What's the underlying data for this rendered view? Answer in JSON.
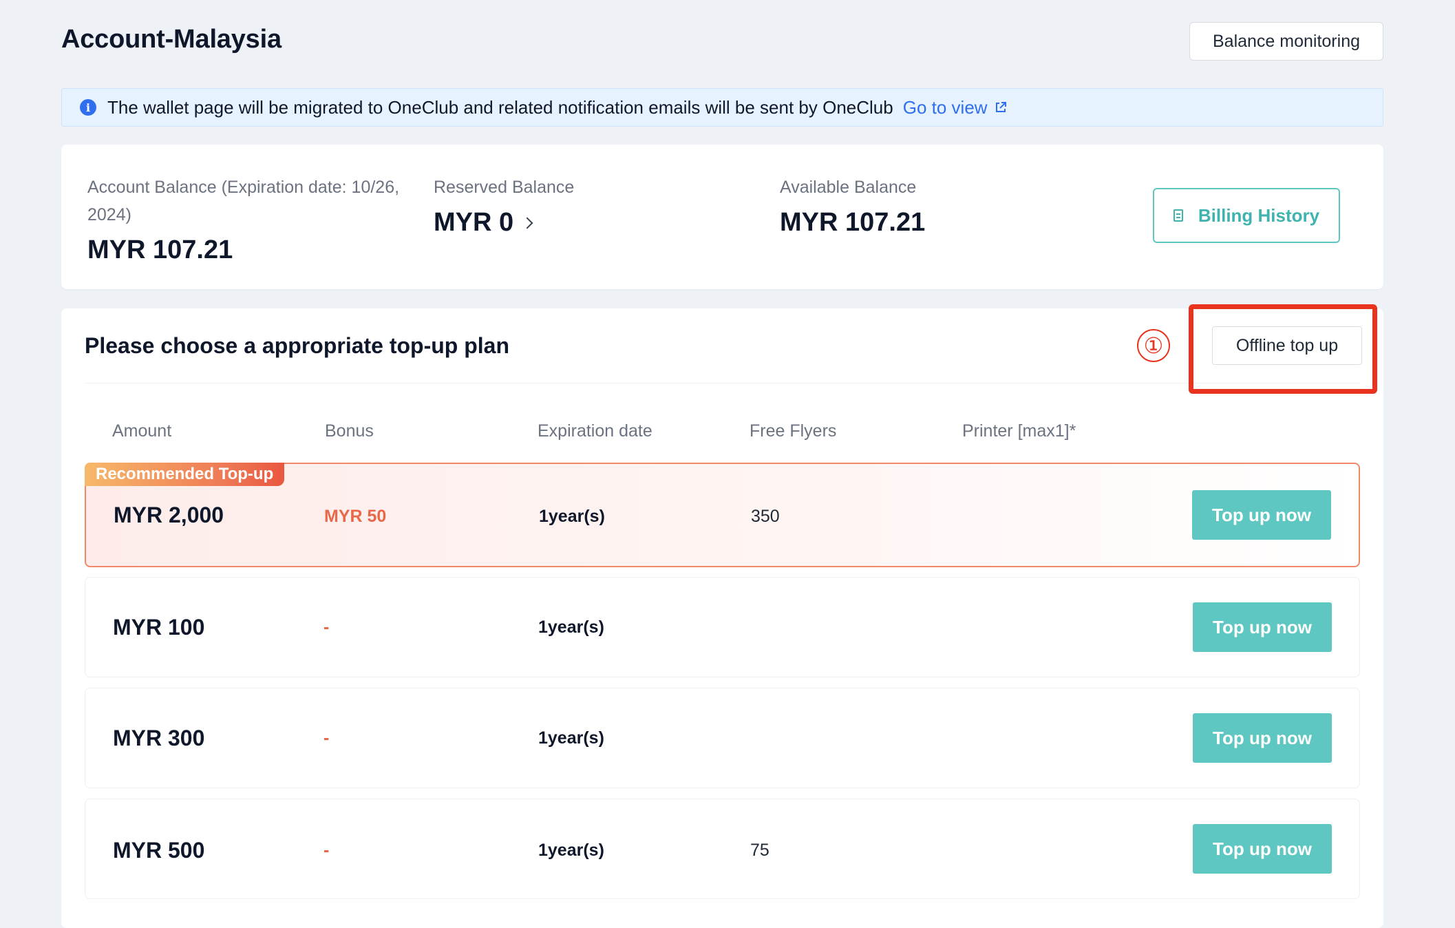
{
  "header": {
    "title": "Account-Malaysia",
    "balance_monitoring_label": "Balance monitoring"
  },
  "notice": {
    "message": "The wallet page will be migrated to OneClub and related notification emails will be sent by OneClub",
    "link_text": "Go to view",
    "icon": "info-icon"
  },
  "balance": {
    "account_label_line1": "Account Balance (Expiration date: 10/26,",
    "account_label_line2": "2024)",
    "account_value": "MYR 107.21",
    "reserved_label": "Reserved Balance",
    "reserved_value": "MYR 0",
    "available_label": "Available Balance",
    "available_value": "MYR 107.21",
    "billing_history_label": "Billing History"
  },
  "plans": {
    "title": "Please choose a appropriate top-up plan",
    "annotation_number": "①",
    "offline_label": "Offline top up",
    "columns": {
      "amount": "Amount",
      "bonus": "Bonus",
      "expiration": "Expiration date",
      "flyers": "Free Flyers",
      "printer": "Printer [max1]*"
    },
    "recommended_badge": "Recommended Top-up",
    "rows": [
      {
        "amount": "MYR 2,000",
        "bonus": "MYR 50",
        "expiration": "1year(s)",
        "flyers": "350",
        "button": "Top up now"
      },
      {
        "amount": "MYR 100",
        "bonus": "-",
        "expiration": "1year(s)",
        "flyers": "",
        "button": "Top up now"
      },
      {
        "amount": "MYR 300",
        "bonus": "-",
        "expiration": "1year(s)",
        "flyers": "",
        "button": "Top up now"
      },
      {
        "amount": "MYR 500",
        "bonus": "-",
        "expiration": "1year(s)",
        "flyers": "75",
        "button": "Top up now"
      }
    ]
  },
  "colors": {
    "accent_teal": "#5ec7c1",
    "link_blue": "#2f6fed",
    "annotation_red": "#e8341f",
    "bonus_orange": "#e8694a"
  }
}
